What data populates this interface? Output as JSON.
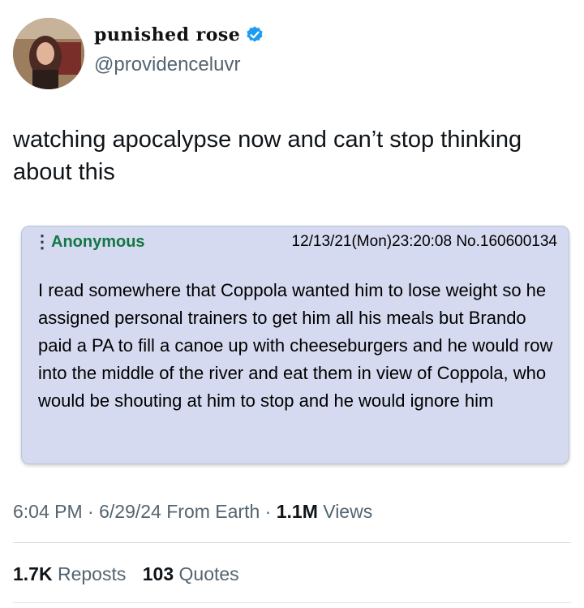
{
  "author": {
    "display_name": "punished rose",
    "handle": "@providenceluvr",
    "verified_color": "#1d9bf0",
    "avatar_icon": "profile-photo"
  },
  "tweet": {
    "text": "watching apocalypse now and can’t stop thinking about this"
  },
  "quoted_post": {
    "poster": "Anonymous",
    "meta": "12/13/21(Mon)23:20:08 No.160600134",
    "body": "I read somewhere that Coppola wanted him to lose weight so he assigned personal trainers to get him all his meals but Brando paid a PA to fill a canoe up with cheeseburgers and he would row into the middle of the river and eat them in view of Coppola, who would be shouting at him to stop and he would ignore him",
    "menu_icon": "vertical-dots-icon",
    "poster_color": "#117743",
    "background_color": "#d6daf0"
  },
  "info": {
    "time": "6:04 PM",
    "separator": " · ",
    "date": "6/29/24",
    "source": "From Earth",
    "views_count": "1.1M",
    "views_label": "Views"
  },
  "stats": {
    "reposts_count": "1.7K",
    "reposts_label": "Reposts",
    "quotes_count": "103",
    "quotes_label": "Quotes"
  }
}
